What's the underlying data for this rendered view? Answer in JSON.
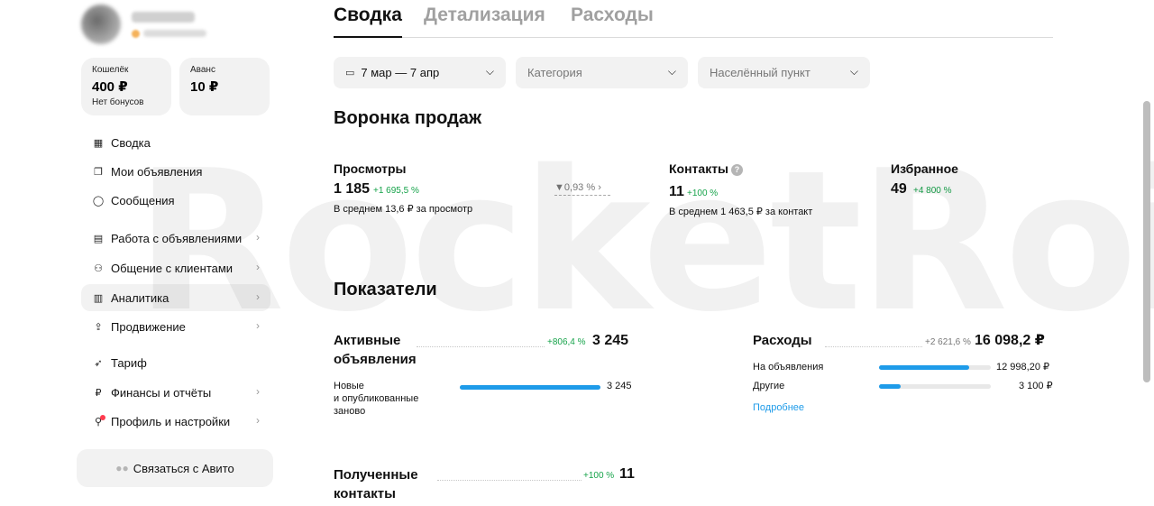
{
  "sidebar": {
    "wallet": {
      "label": "Кошелёк",
      "value": "400 ₽",
      "note": "Нет бонусов"
    },
    "advance": {
      "label": "Аванс",
      "value": "10 ₽"
    },
    "nav": [
      {
        "label": "Сводка",
        "icon": "grid-icon"
      },
      {
        "label": "Мои объявления",
        "icon": "copy-icon"
      },
      {
        "label": "Сообщения",
        "icon": "chat-icon"
      },
      {
        "label": "Работа с объявлениями",
        "icon": "ads-icon"
      },
      {
        "label": "Общение с клиентами",
        "icon": "users-icon"
      },
      {
        "label": "Аналитика",
        "icon": "bar-chart-icon"
      },
      {
        "label": "Продвижение",
        "icon": "promote-icon"
      },
      {
        "label": "Тариф",
        "icon": "rocket-icon"
      },
      {
        "label": "Финансы и отчёты",
        "icon": "ruble-icon"
      },
      {
        "label": "Профиль и настройки",
        "icon": "profile-icon"
      }
    ],
    "contact_button": "Связаться с Авито"
  },
  "tabs": [
    "Сводка",
    "Детализация",
    "Расходы"
  ],
  "filters": {
    "date": "7 мар — 7 апр",
    "category": "Категория",
    "city": "Населённый пункт"
  },
  "funnel": {
    "title": "Воронка продаж",
    "views": {
      "label": "Просмотры",
      "value": "1 185",
      "delta": "+1 695,5 %",
      "note": "В среднем 13,6 ₽ за просмотр",
      "conversion": "0,93 %"
    },
    "contacts": {
      "label": "Контакты",
      "value": "11",
      "delta": "+100 %",
      "note": "В среднем 1 463,5 ₽ за контакт"
    },
    "favorites": {
      "label": "Избранное",
      "value": "49",
      "delta": "+4 800 %"
    }
  },
  "indicators": {
    "title": "Показатели",
    "active_ads": {
      "label_line1": "Активные",
      "label_line2": "объявления",
      "delta": "+806,4 %",
      "value": "3 245",
      "sub_label_line1": "Новые",
      "sub_label_line2": "и опубликованные",
      "sub_label_line3": "заново",
      "sub_value": "3 245",
      "sub_fraction": 1.0
    },
    "expenses": {
      "label": "Расходы",
      "delta": "+2 621,6 %",
      "value": "16 098,2 ₽",
      "rows": [
        {
          "label": "На объявления",
          "value": "12 998,20 ₽",
          "fraction": 0.81
        },
        {
          "label": "Другие",
          "value": "3 100 ₽",
          "fraction": 0.19
        }
      ],
      "more_link": "Подробнее"
    },
    "received_contacts": {
      "label_line1": "Полученные",
      "label_line2": "контакты",
      "delta": "+100 %",
      "value": "11"
    }
  },
  "watermark": "RocketRoi",
  "colors": {
    "accent": "#1e9be9",
    "positive": "#16a34a",
    "card_bg": "#f2f2f2",
    "badge": "#ff3b4e"
  }
}
